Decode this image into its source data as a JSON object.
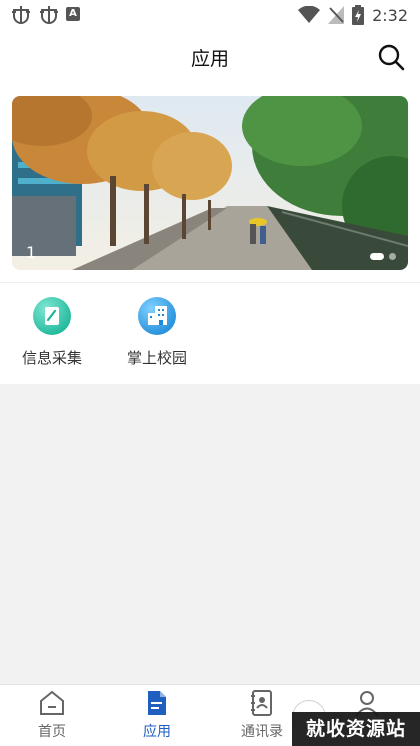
{
  "status_bar": {
    "time": "2:32"
  },
  "header": {
    "title": "应用"
  },
  "banner": {
    "index": "1",
    "dot_count": 2,
    "active_dot": 0
  },
  "apps": [
    {
      "label": "信息采集",
      "icon": "edit-icon",
      "color": "#22c3a6"
    },
    {
      "label": "掌上校园",
      "icon": "building-icon",
      "color": "#2a9be0"
    }
  ],
  "tabbar": {
    "active": 1,
    "items": [
      {
        "label": "首页",
        "icon": "home-icon"
      },
      {
        "label": "应用",
        "icon": "document-icon"
      },
      {
        "label": "通讯录",
        "icon": "contacts-book-icon"
      },
      {
        "label": "",
        "icon": "person-icon"
      }
    ]
  },
  "watermark": {
    "text": "就收资源站"
  },
  "colors": {
    "accent": "#1f5fbf",
    "background": "#f2f2f2"
  }
}
